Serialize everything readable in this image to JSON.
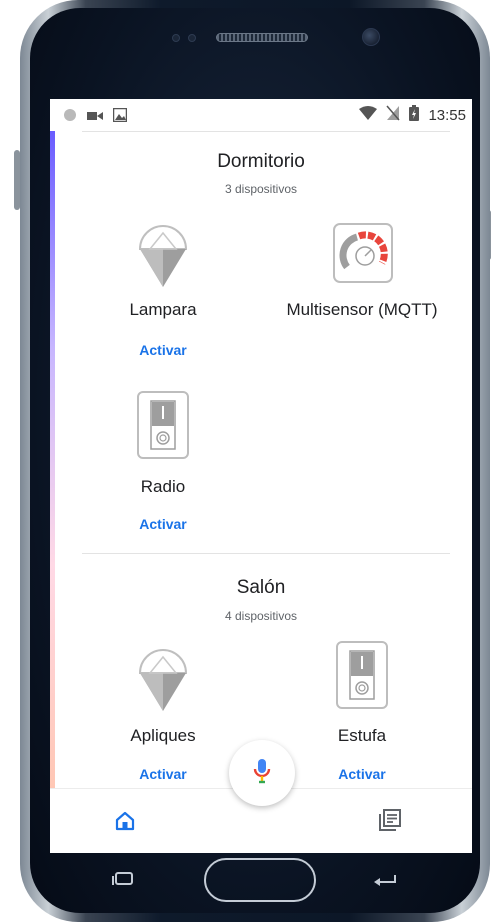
{
  "status_bar": {
    "time": "13:55",
    "left_icons": [
      "circle-icon",
      "video-icon",
      "image-icon"
    ],
    "right_icons": [
      "wifi-icon",
      "no-sim-icon",
      "battery-icon"
    ]
  },
  "rooms": [
    {
      "name": "Dormitorio",
      "count": "3 dispositivos",
      "devices": [
        {
          "name": "Lampara",
          "icon": "lamp-icon",
          "action": "Activar"
        },
        {
          "name": "Multisensor (MQTT)",
          "icon": "gauge-icon",
          "action": ""
        },
        {
          "name": "Radio",
          "icon": "switch-icon",
          "action": "Activar"
        }
      ]
    },
    {
      "name": "Salón",
      "count": "4 dispositivos",
      "devices": [
        {
          "name": "Apliques",
          "icon": "lamp-icon",
          "action": "Activar"
        },
        {
          "name": "Estufa",
          "icon": "switch-icon",
          "action": "Activar"
        }
      ]
    }
  ],
  "bottom_nav": {
    "items": [
      {
        "icon": "home-icon",
        "active": true
      },
      {
        "icon": "list-icon",
        "active": false
      }
    ]
  },
  "colors": {
    "accent": "#1a73e8",
    "text": "#202124",
    "subtext": "#5f6368",
    "gauge_red": "#e8453c"
  }
}
